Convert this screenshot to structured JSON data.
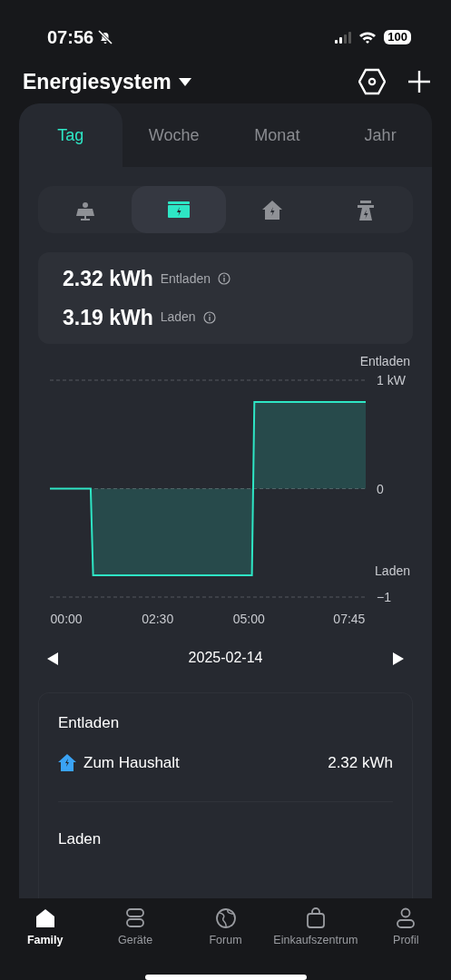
{
  "status_bar": {
    "time": "07:56",
    "battery": "100"
  },
  "header": {
    "title": "Energiesystem"
  },
  "tabs": [
    {
      "label": "Tag",
      "selected": true
    },
    {
      "label": "Woche",
      "selected": false
    },
    {
      "label": "Monat",
      "selected": false
    },
    {
      "label": "Jahr",
      "selected": false
    }
  ],
  "segments": [
    {
      "kind": "solar",
      "selected": false
    },
    {
      "kind": "battery",
      "selected": true
    },
    {
      "kind": "home",
      "selected": false
    },
    {
      "kind": "grid",
      "selected": false
    }
  ],
  "summary": [
    {
      "value": "2.32 kWh",
      "label": "Entladen"
    },
    {
      "value": "3.19 kWh",
      "label": "Laden"
    }
  ],
  "chart_data": {
    "type": "area",
    "x": [
      -27,
      40,
      44,
      305,
      309,
      492
    ],
    "series": [
      {
        "color": "#2ee6c5",
        "values": [
          0,
          0,
          -0.8,
          -0.8,
          0.8,
          0.8
        ]
      }
    ],
    "xlim": [
      -27,
      492
    ],
    "ylim": [
      -1,
      1
    ],
    "xticks": [
      {
        "value": 0,
        "label": "00:00"
      },
      {
        "value": 150,
        "label": "02:30"
      },
      {
        "value": 300,
        "label": "05:00"
      },
      {
        "value": 465,
        "label": "07:45"
      }
    ],
    "yticks": [
      {
        "value": 1,
        "label": "1 kW"
      },
      {
        "value": 0,
        "label": "0"
      },
      {
        "value": -1,
        "label": "−1"
      }
    ],
    "annotations": [
      "Entladen",
      "Laden"
    ]
  },
  "date": "2025-02-14",
  "details": [
    {
      "heading": "Entladen",
      "rows": [
        {
          "label": "Zum Haushalt",
          "value": "2.32 kWh"
        }
      ]
    },
    {
      "heading": "Laden"
    }
  ],
  "bottom_nav": [
    {
      "label": "Family",
      "kind": "home",
      "selected": true
    },
    {
      "label": "Geräte",
      "kind": "devices",
      "selected": false
    },
    {
      "label": "Forum",
      "kind": "globe",
      "selected": false
    },
    {
      "label": "Einkaufszentrum",
      "kind": "bag",
      "selected": false
    },
    {
      "label": "Profil",
      "kind": "person",
      "selected": false
    }
  ]
}
